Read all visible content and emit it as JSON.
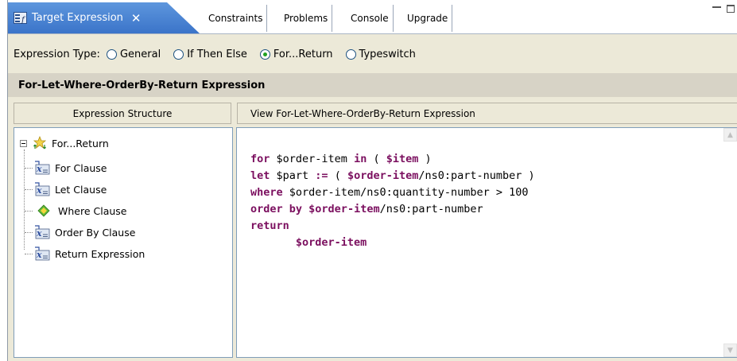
{
  "tabs": {
    "active": {
      "label": "Target Expression",
      "close": "✕"
    },
    "others": [
      {
        "id": "constraints",
        "label": "Constraints"
      },
      {
        "id": "problems",
        "label": "Problems"
      },
      {
        "id": "console",
        "label": "Console"
      },
      {
        "id": "upgrade",
        "label": "Upgrade"
      }
    ]
  },
  "expression_type": {
    "label": "Expression Type:",
    "options": [
      "General",
      "If Then Else",
      "For...Return",
      "Typeswitch"
    ],
    "selected": "For...Return"
  },
  "section_title": "For-Let-Where-OrderBy-Return Expression",
  "left_panel": {
    "header": "Expression Structure",
    "tree": {
      "root": "For...Return",
      "children": [
        "For Clause",
        "Let Clause",
        "Where Clause",
        "Order By Clause",
        "Return Expression"
      ]
    }
  },
  "right_panel": {
    "header": "View For-Let-Where-OrderBy-Return Expression",
    "code": {
      "l1": {
        "k1": "for",
        "t1": " $order-item ",
        "k2": "in",
        "t2": " ( ",
        "v1": "$item",
        "t3": " )"
      },
      "l2": {
        "k1": "let",
        "t1": " $part ",
        "k2": ":=",
        "t2": " ( ",
        "v1": "$order-item",
        "t3": "/ns0:part-number )"
      },
      "l3": {
        "k1": "where",
        "t1": " $order-item/ns0:quantity-number > 100"
      },
      "l4": {
        "k1": "order by",
        "t1": " ",
        "v1": "$order-item",
        "t2": "/ns0:part-number"
      },
      "l5": {
        "k1": "return"
      },
      "l6": {
        "indent": "       ",
        "v1": "$order-item"
      }
    }
  },
  "colors": {
    "active_tab": "#3b74c9",
    "keyword": "#7b0f5f",
    "radio_selected": "#21a121"
  }
}
